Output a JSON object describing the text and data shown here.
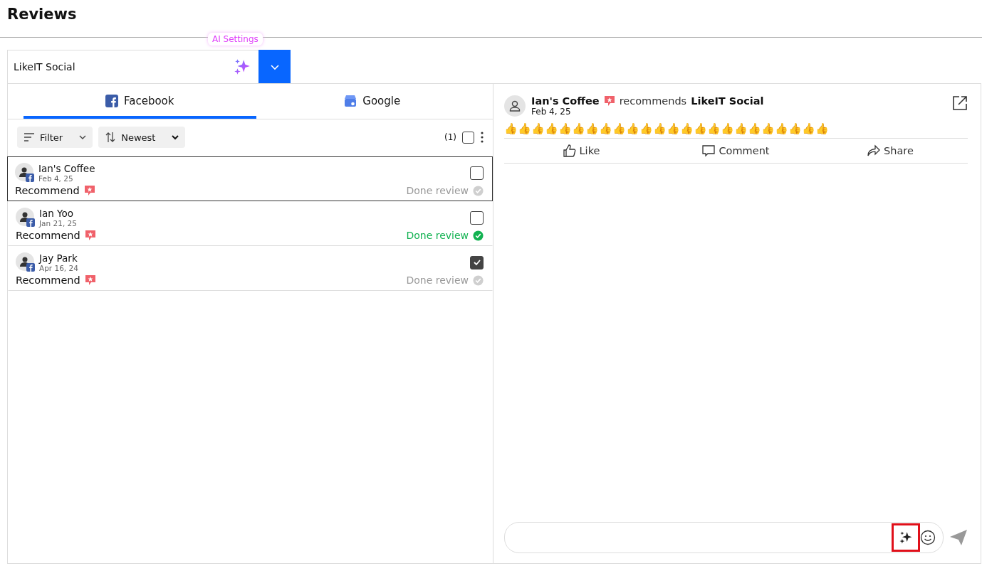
{
  "page_title": "Reviews",
  "account": {
    "name": "LikeIT Social",
    "tooltip": "AI Settings"
  },
  "tabs": [
    {
      "label": "Facebook",
      "kind": "facebook",
      "selected": true
    },
    {
      "label": "Google",
      "kind": "google",
      "selected": false
    }
  ],
  "toolbar": {
    "filter": "Filter",
    "sort": "Newest",
    "selected_count": "(1)",
    "select_all_checked": false
  },
  "reviews": [
    {
      "name": "Ian's Coffee",
      "date": "Feb 4, 25",
      "type": "Recommend",
      "status": "Done review",
      "done": false,
      "checked": false,
      "selected": true
    },
    {
      "name": "Ian Yoo",
      "date": "Jan 21, 25",
      "type": "Recommend",
      "status": "Done review",
      "done": true,
      "checked": false,
      "selected": false
    },
    {
      "name": "Jay Park",
      "date": "Apr 16, 24",
      "type": "Recommend",
      "status": "Done review",
      "done": false,
      "checked": true,
      "selected": false
    }
  ],
  "detail": {
    "author": "Ian's Coffee",
    "verb": "recommends",
    "page": "LikeIT Social",
    "date": "Feb 4, 25",
    "text": "👍👍👍👍👍👍👍👍👍👍👍👍👍👍👍👍👍👍👍👍👍👍👍👍",
    "actions": [
      {
        "label": "Like",
        "kind": "like"
      },
      {
        "label": "Comment",
        "kind": "comment"
      },
      {
        "label": "Share",
        "kind": "share"
      }
    ]
  },
  "composer": {
    "ai_highlighted": true
  }
}
